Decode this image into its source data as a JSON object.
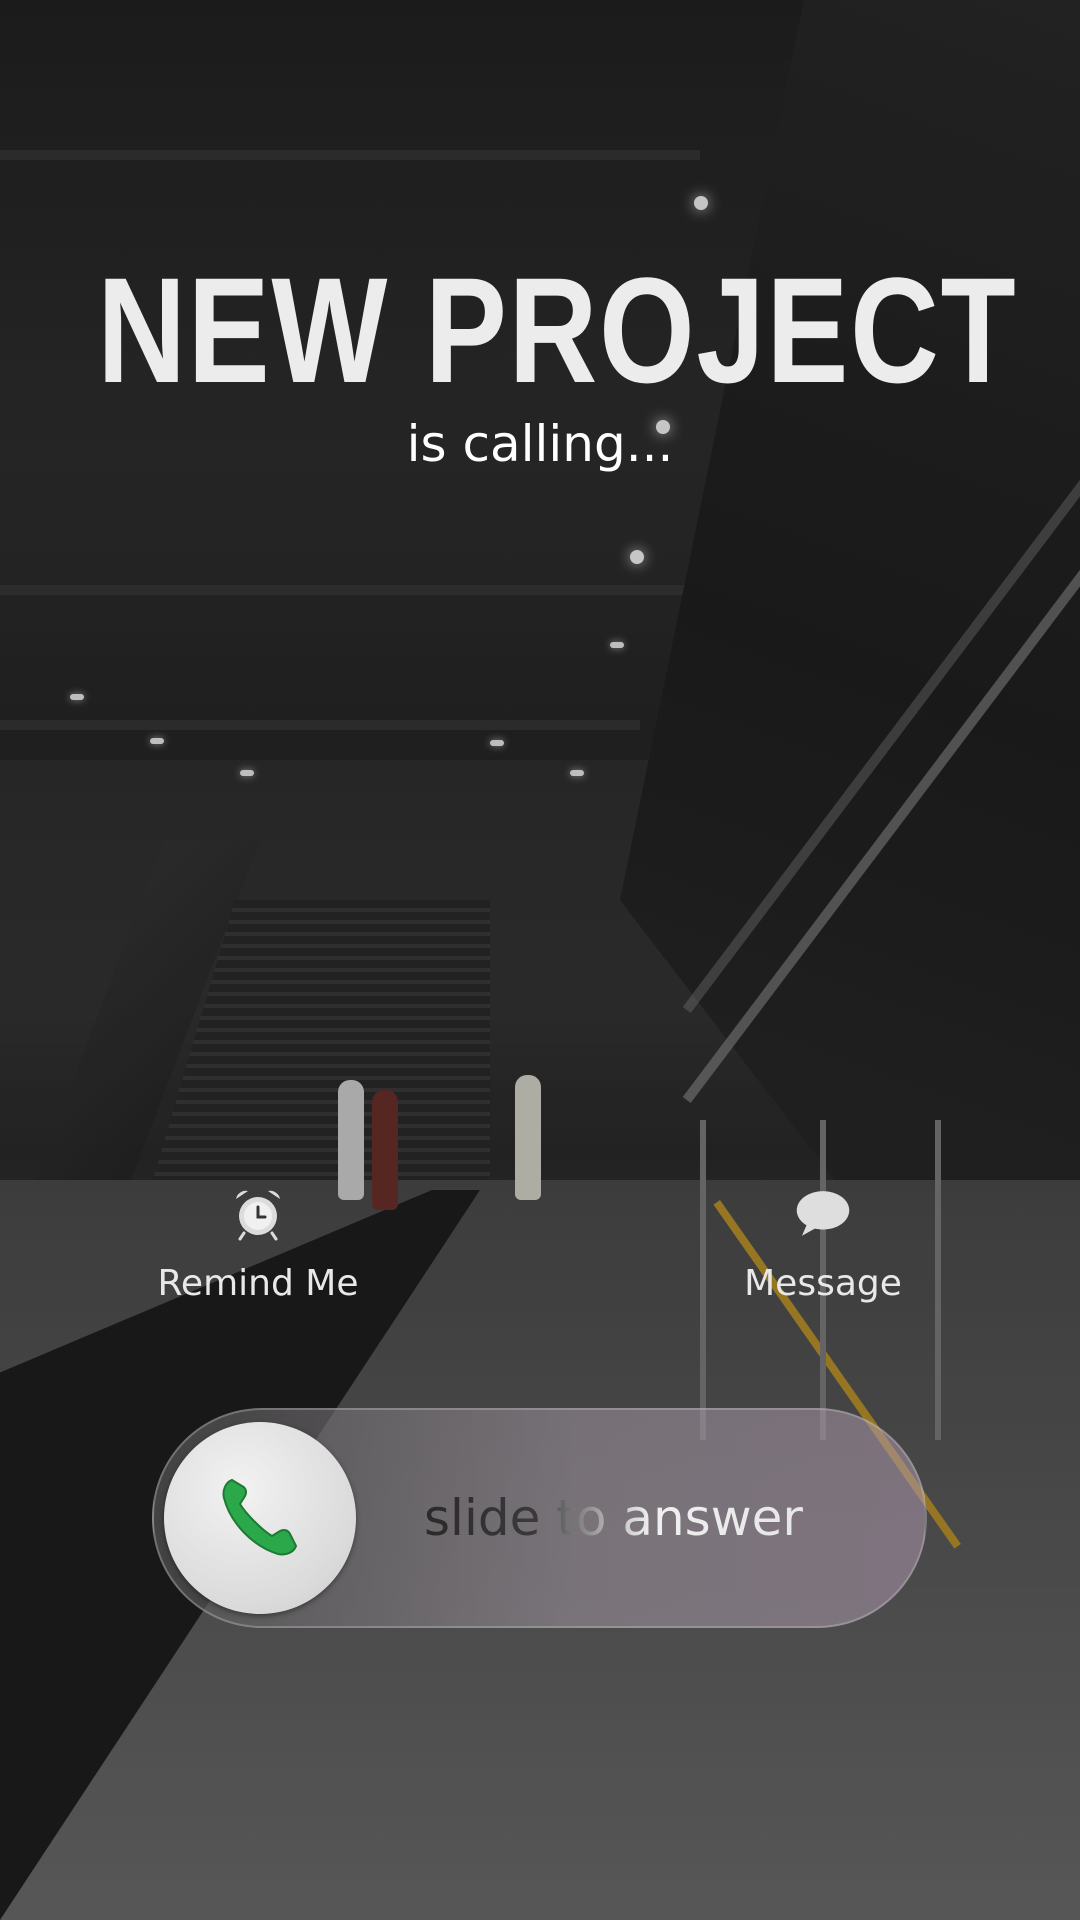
{
  "call": {
    "caller_name": "NEW PROJECT",
    "status": "is calling..."
  },
  "actions": {
    "remind": {
      "label": "Remind Me",
      "icon": "alarm-clock-icon"
    },
    "message": {
      "label": "Message",
      "icon": "speech-bubble-icon"
    }
  },
  "slider": {
    "label": "slide to answer",
    "icon": "phone-icon",
    "icon_color": "#2aa84a"
  }
}
